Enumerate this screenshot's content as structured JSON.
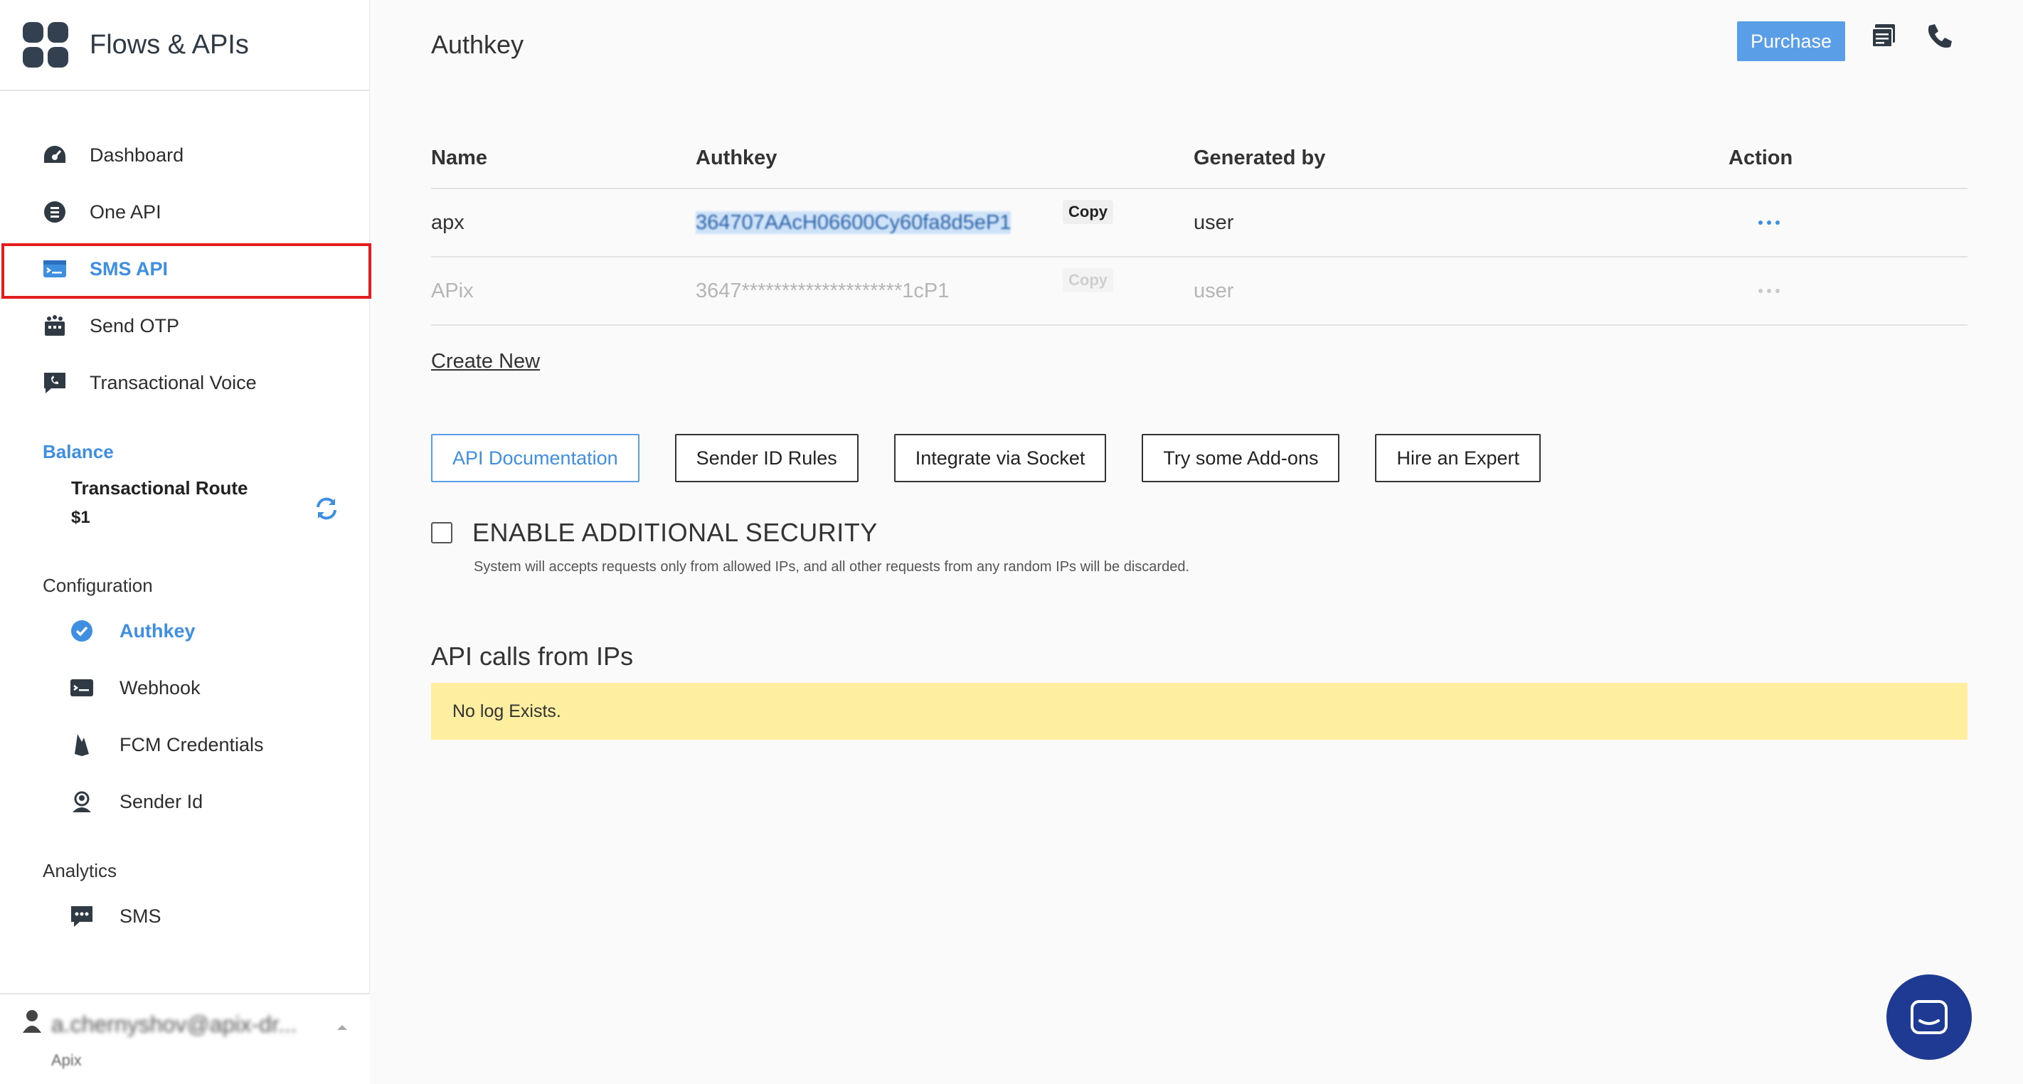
{
  "app": {
    "title": "Flows & APIs"
  },
  "sidebar": {
    "items": [
      {
        "label": "Dashboard",
        "icon": "dashboard-icon"
      },
      {
        "label": "One API",
        "icon": "one-api-icon"
      },
      {
        "label": "SMS API",
        "icon": "sms-api-icon",
        "active": true
      },
      {
        "label": "Send OTP",
        "icon": "send-otp-icon"
      },
      {
        "label": "Transactional Voice",
        "icon": "voice-icon"
      }
    ],
    "balance": {
      "title": "Balance",
      "route": "Transactional Route",
      "amount": "$1"
    },
    "configuration": {
      "title": "Configuration",
      "items": [
        {
          "label": "Authkey",
          "icon": "check-circle-icon",
          "active": true
        },
        {
          "label": "Webhook",
          "icon": "webhook-icon"
        },
        {
          "label": "FCM Credentials",
          "icon": "firebase-icon"
        },
        {
          "label": "Sender Id",
          "icon": "sender-id-icon"
        }
      ]
    },
    "analytics": {
      "title": "Analytics",
      "items": [
        {
          "label": "SMS",
          "icon": "sms-chat-icon"
        }
      ]
    },
    "user": {
      "email": "a.chernyshov@apix-dr...",
      "org": "Apix"
    }
  },
  "header": {
    "title": "Authkey",
    "purchase_label": "Purchase"
  },
  "table": {
    "columns": [
      "Name",
      "Authkey",
      "Generated by",
      "Action"
    ],
    "rows": [
      {
        "name": "apx",
        "authkey": "364707AAcH06600Cy60fa8d5eP1",
        "copy": "Copy",
        "generated_by": "user"
      },
      {
        "name": "APix",
        "authkey": "3647********************1cP1",
        "copy": "Copy",
        "generated_by": "user"
      }
    ]
  },
  "create_new": "Create New",
  "buttons": [
    "API Documentation",
    "Sender ID Rules",
    "Integrate via Socket",
    "Try some Add-ons",
    "Hire an Expert"
  ],
  "security": {
    "title": "ENABLE ADDITIONAL SECURITY",
    "description": "System will accepts requests only from allowed IPs, and all other requests from any random IPs will be discarded."
  },
  "ip_section": {
    "title": "API calls from IPs",
    "empty_message": "No log Exists."
  },
  "colors": {
    "accent": "#3f8fe0",
    "highlight_box": "#e11d1d",
    "log_bg": "#fdeea0",
    "chat_bubble": "#1f3a93"
  }
}
